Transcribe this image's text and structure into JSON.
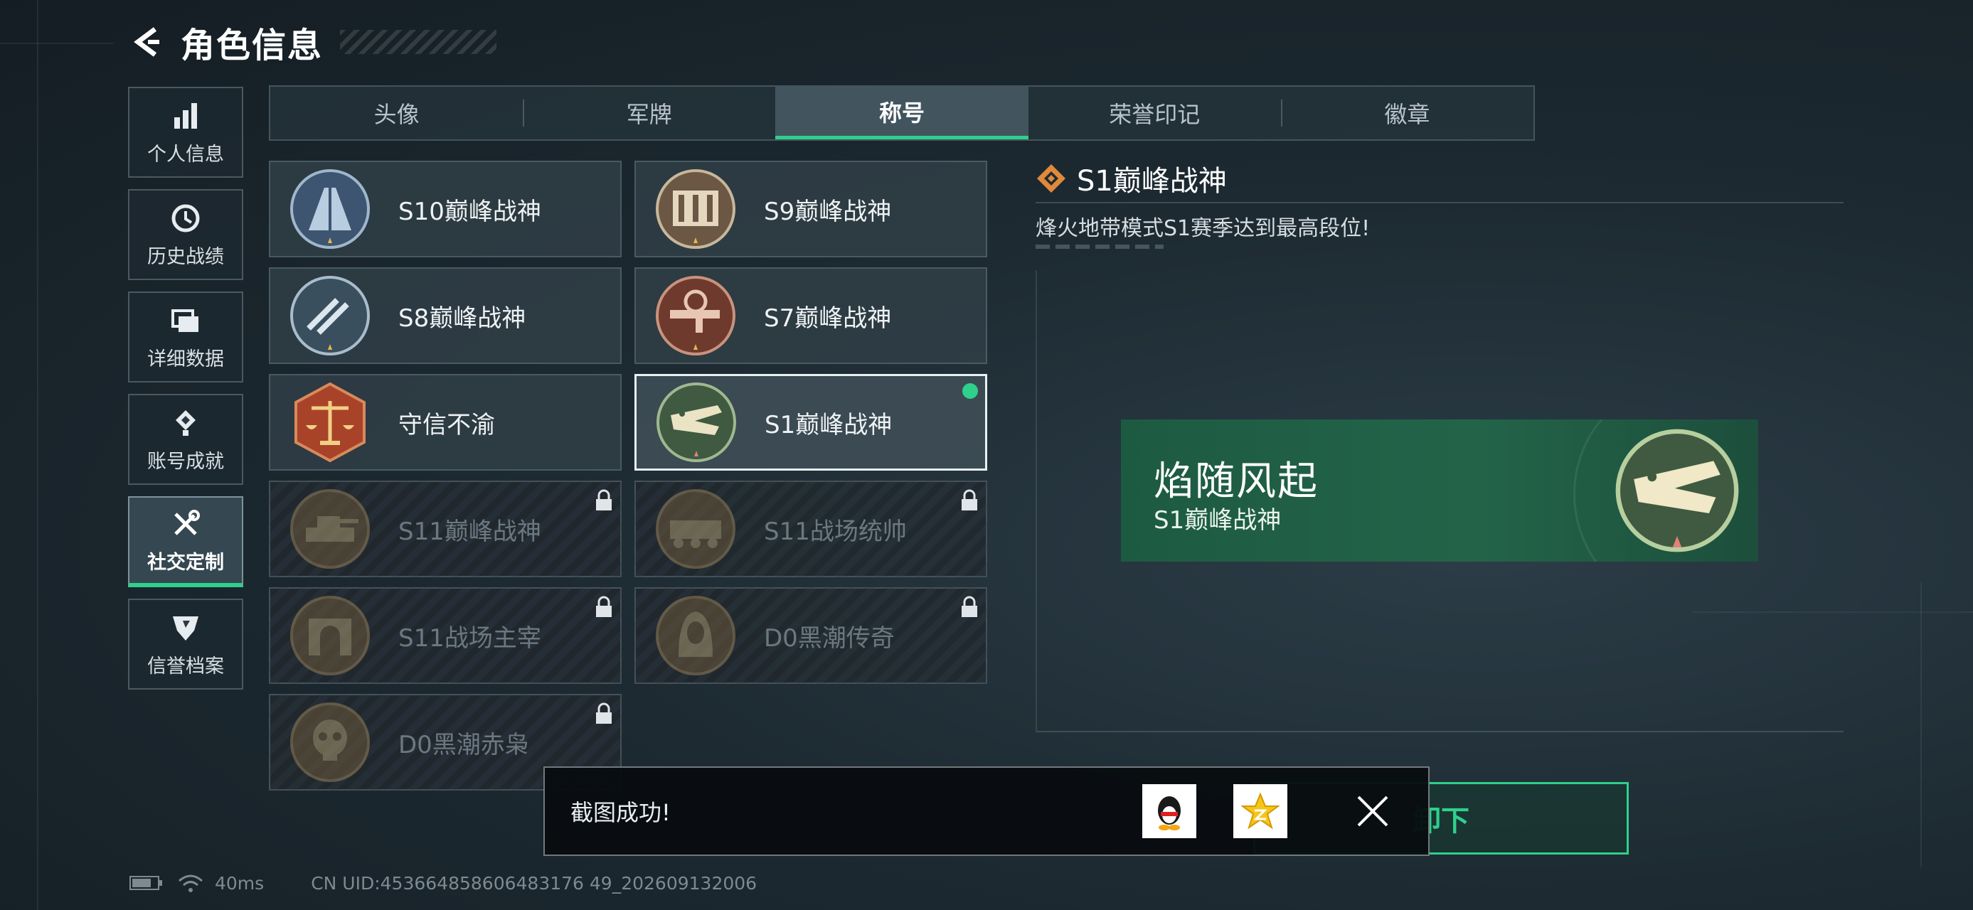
{
  "header": {
    "title": "角色信息"
  },
  "side_nav": [
    {
      "label": "个人信息",
      "icon": "bar-chart-icon",
      "active": false
    },
    {
      "label": "历史战绩",
      "icon": "clock-icon",
      "active": false
    },
    {
      "label": "详细数据",
      "icon": "folder-icon",
      "active": false
    },
    {
      "label": "账号成就",
      "icon": "medal-icon",
      "active": false
    },
    {
      "label": "社交定制",
      "icon": "tools-icon",
      "active": true
    },
    {
      "label": "信誉档案",
      "icon": "shield-icon",
      "active": false
    }
  ],
  "tabs": [
    {
      "label": "头像",
      "active": false
    },
    {
      "label": "军牌",
      "active": false
    },
    {
      "label": "称号",
      "active": true
    },
    {
      "label": "荣誉印记",
      "active": false
    },
    {
      "label": "徽章",
      "active": false
    }
  ],
  "titles": [
    {
      "name": "S10巅峰战神",
      "emblem": "tower-emblem-icon",
      "locked": false,
      "selected": false
    },
    {
      "name": "S9巅峰战神",
      "emblem": "dam-emblem-icon",
      "locked": false,
      "selected": false
    },
    {
      "name": "S8巅峰战神",
      "emblem": "stripes-emblem-icon",
      "locked": false,
      "selected": false
    },
    {
      "name": "S7巅峰战神",
      "emblem": "rifle-emblem-icon",
      "locked": false,
      "selected": false
    },
    {
      "name": "守信不渝",
      "emblem": "scales-emblem-icon",
      "locked": false,
      "selected": false
    },
    {
      "name": "S1巅峰战神",
      "emblem": "crocodile-emblem-icon",
      "locked": false,
      "selected": true
    },
    {
      "name": "S11巅峰战神",
      "emblem": "tank-emblem-icon",
      "locked": true,
      "selected": false
    },
    {
      "name": "S11战场统帅",
      "emblem": "apc-emblem-icon",
      "locked": true,
      "selected": false
    },
    {
      "name": "S11战场主宰",
      "emblem": "arch-emblem-icon",
      "locked": true,
      "selected": false
    },
    {
      "name": "D0黑潮传奇",
      "emblem": "hooded-emblem-icon",
      "locked": true,
      "selected": false
    },
    {
      "name": "D0黑潮赤枭",
      "emblem": "skull-emblem-icon",
      "locked": true,
      "selected": false
    }
  ],
  "detail": {
    "title": "S1巅峰战神",
    "description": "烽火地带模式S1赛季达到最高段位!",
    "banner_main": "焰随风起",
    "banner_sub": "S1巅峰战神"
  },
  "unequip_button": "卸下",
  "toast": {
    "message": "截图成功!",
    "share_qq_icon": "qq-penguin-icon",
    "share_qzone_icon": "qzone-star-icon"
  },
  "footer": {
    "ping": "40ms",
    "uid": "CN UID:453664858606483176 49_202609132006"
  },
  "colors": {
    "accent": "#2ed08c",
    "banner": "#236449",
    "title_diamond": "#e0893a"
  }
}
